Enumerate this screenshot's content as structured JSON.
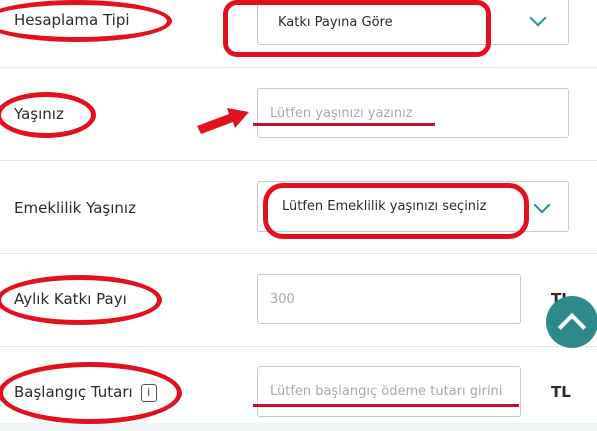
{
  "form": {
    "calc_type": {
      "label": "Hesaplama Tipi",
      "value": "Katkı Payına Göre"
    },
    "age": {
      "label": "Yaşınız",
      "placeholder": "Lütfen yaşınızı yazınız"
    },
    "retirement_age": {
      "label": "Emeklilik Yaşınız",
      "placeholder": "Lütfen Emeklilik yaşınızı seçiniz"
    },
    "monthly": {
      "label": "Aylık Katkı Payı",
      "placeholder": "300",
      "unit": "TL"
    },
    "initial": {
      "label": "Başlangıç Tutarı",
      "info": "i",
      "placeholder": "Lütfen başlangıç ödeme tutarı girini",
      "unit": "TL"
    }
  },
  "icons": {
    "dropdown": "chevron-down-icon",
    "scroll_top": "chevron-up-icon",
    "info": "info-icon"
  },
  "colors": {
    "accent": "#2e8a8a",
    "annotation": "#e3101e"
  }
}
